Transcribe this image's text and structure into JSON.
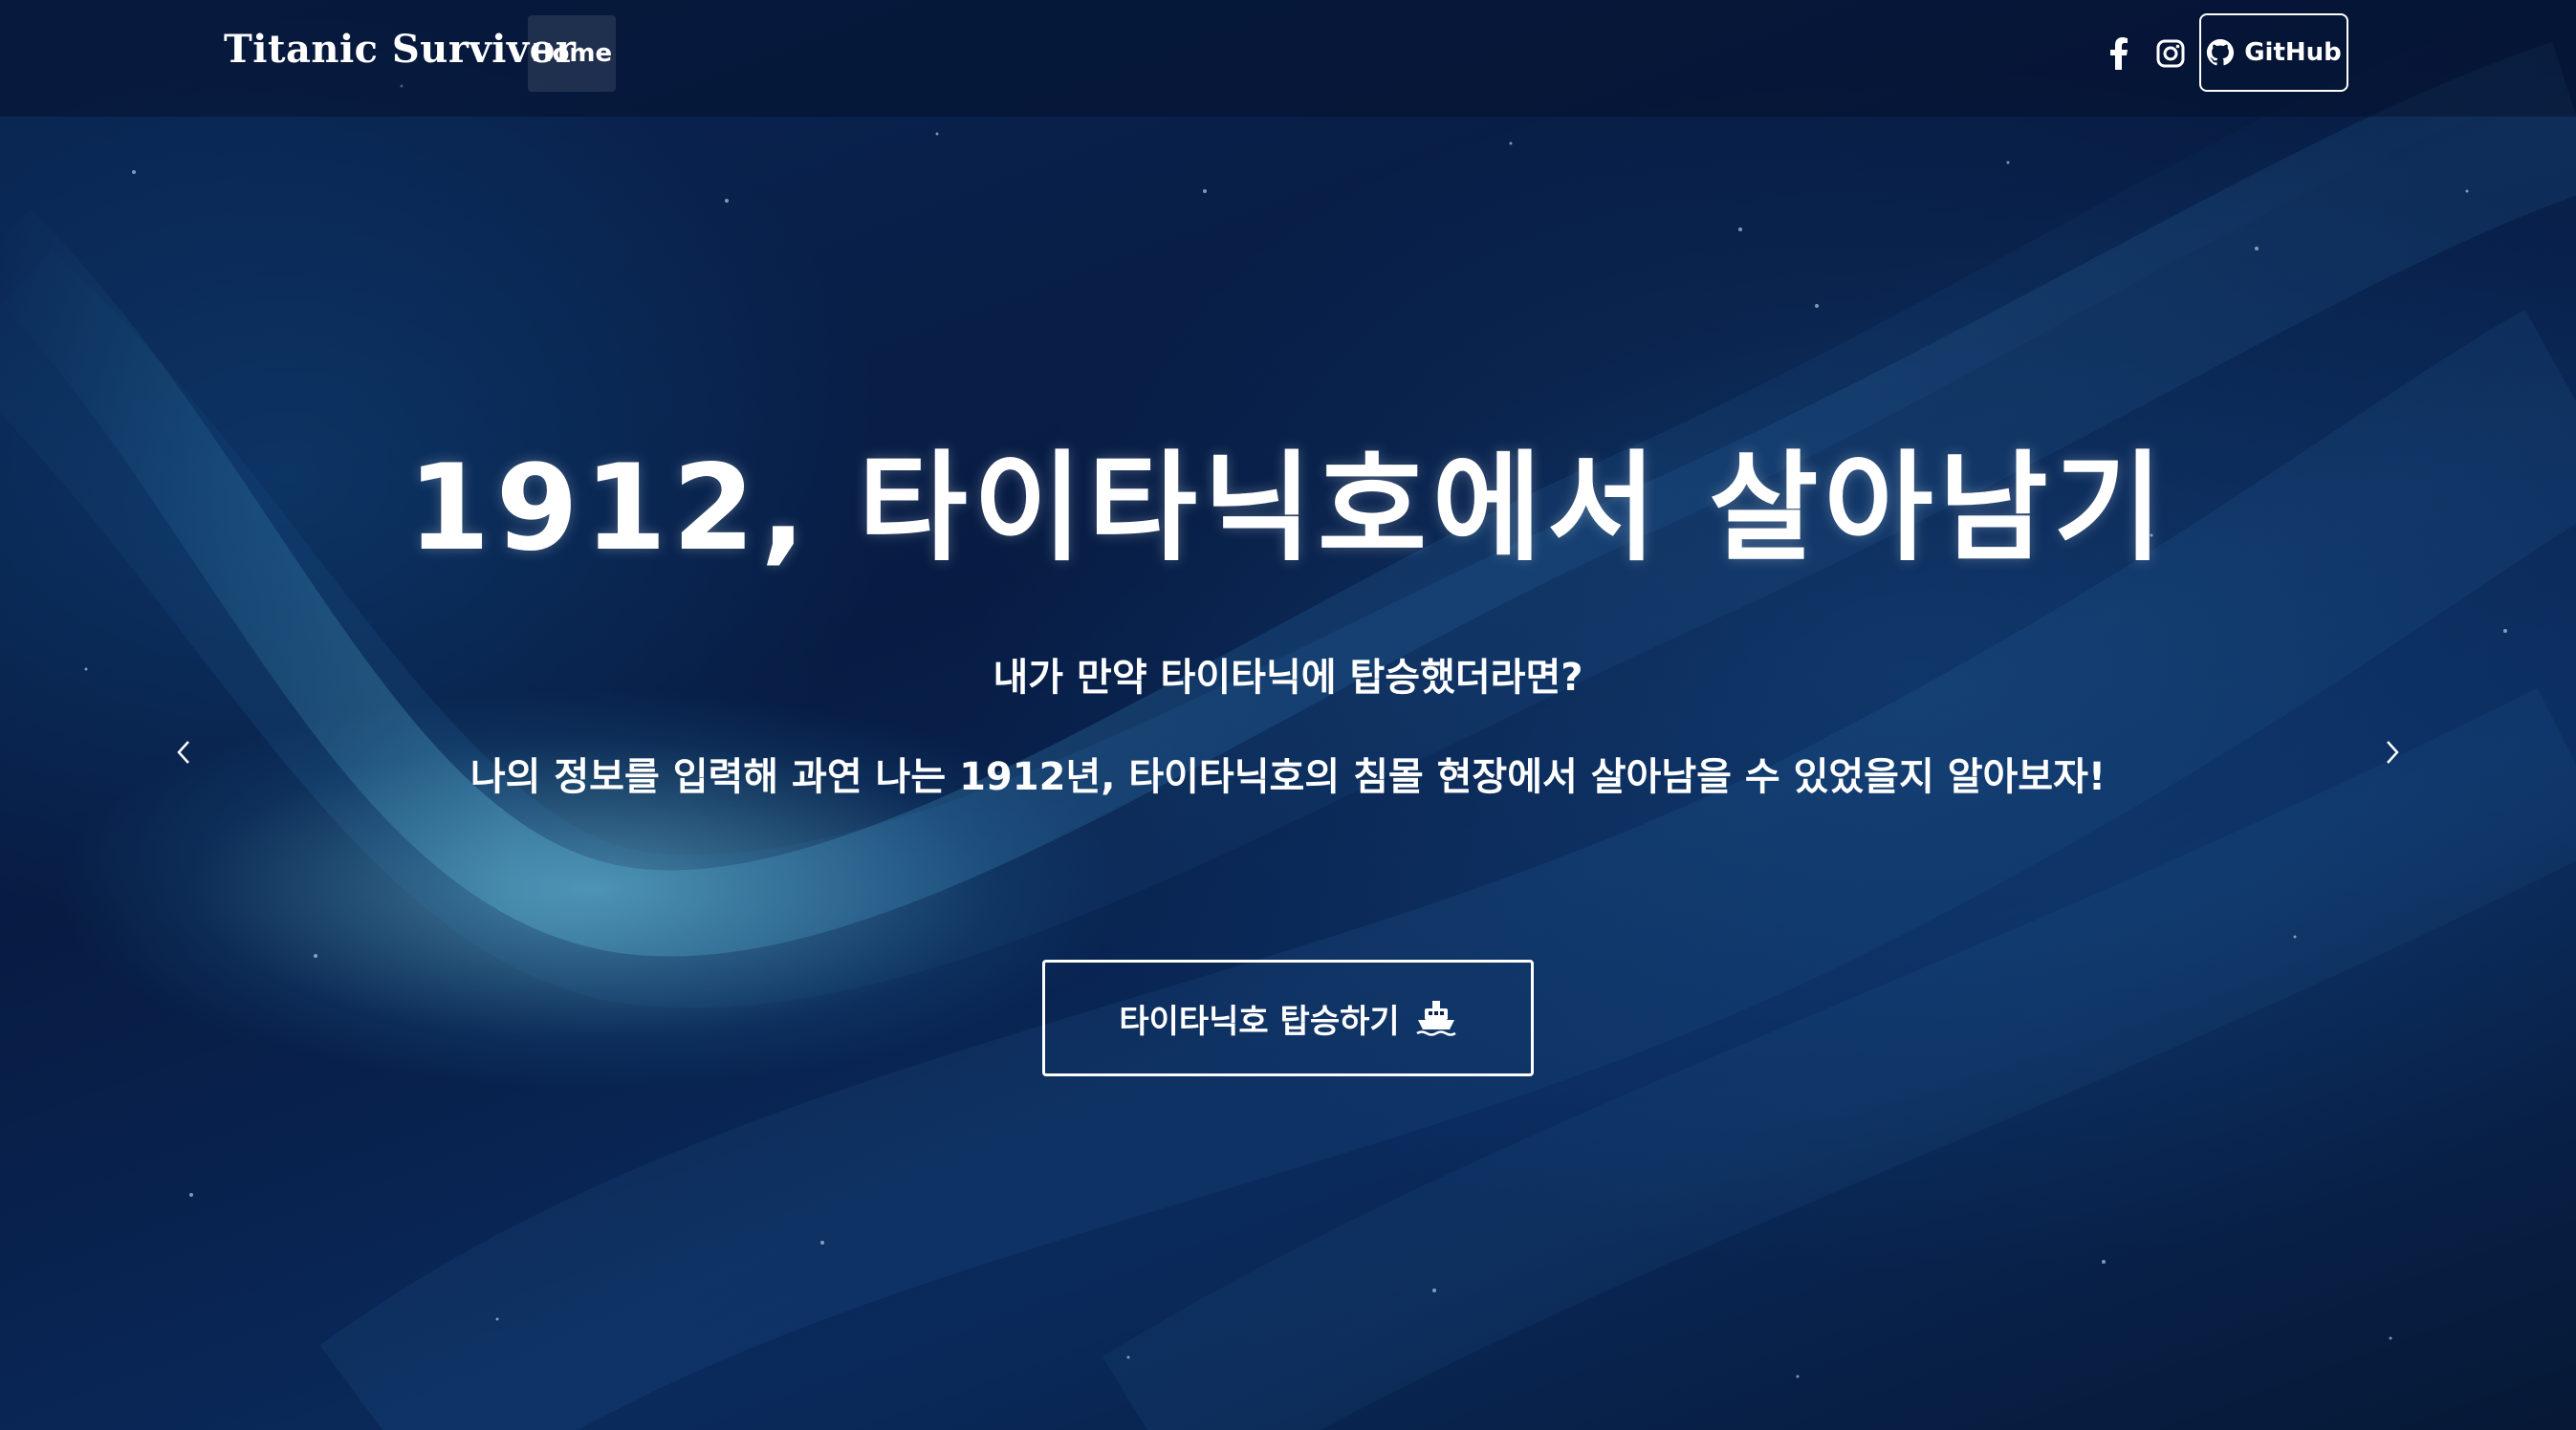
{
  "nav": {
    "brand": "Titanic Survivor",
    "home_label": "Home",
    "social_icons": [
      "facebook-icon",
      "instagram-icon"
    ],
    "github_label": "GitHub",
    "github_icon": "github-icon"
  },
  "hero": {
    "title": "1912, 타이타닉호에서 살아남기",
    "subtitle_1": "내가 만약 타이타닉에 탑승했더라면?",
    "subtitle_2": "나의 정보를 입력해 과연 나는 1912년, 타이타닉호의 침몰 현장에서 살아남을 수 있었을지 알아보자!",
    "cta_label": "타이타닉호 탑승하기",
    "cta_icon": "ship-icon"
  },
  "carousel": {
    "prev_icon": "chevron-left-icon",
    "next_icon": "chevron-right-icon"
  },
  "colors": {
    "background": "#071c43",
    "text": "#ffffff",
    "accent_glow": "#78d2e6"
  }
}
